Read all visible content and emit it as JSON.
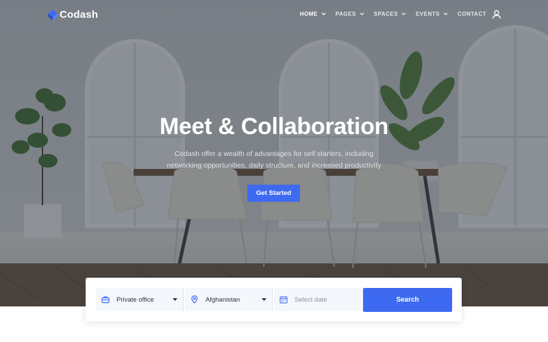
{
  "brand": {
    "name": "Codash",
    "accent_color": "#3d6af0",
    "logo_icon": "diamond-logo-icon"
  },
  "nav": {
    "items": [
      {
        "label": "HOME",
        "has_dropdown": true,
        "active": true
      },
      {
        "label": "PAGES",
        "has_dropdown": true,
        "active": false
      },
      {
        "label": "SPACES",
        "has_dropdown": true,
        "active": false
      },
      {
        "label": "EVENTS",
        "has_dropdown": true,
        "active": false
      },
      {
        "label": "CONTACT",
        "has_dropdown": false,
        "active": false
      }
    ],
    "user_icon": "user-icon"
  },
  "hero": {
    "title": "Meet & Collaboration",
    "subtitle_line1": "Codash offer a wealth of advantages for self starters, including",
    "subtitle_line2": "networking opportunities, daily structure, and increased productivity",
    "cta_label": "Get Started"
  },
  "search": {
    "space_type": {
      "value": "Private office",
      "icon": "briefcase-icon"
    },
    "location": {
      "value": "Afghanistan",
      "icon": "map-pin-icon"
    },
    "date": {
      "placeholder": "Select date",
      "icon": "calendar-icon"
    },
    "button_label": "Search"
  }
}
